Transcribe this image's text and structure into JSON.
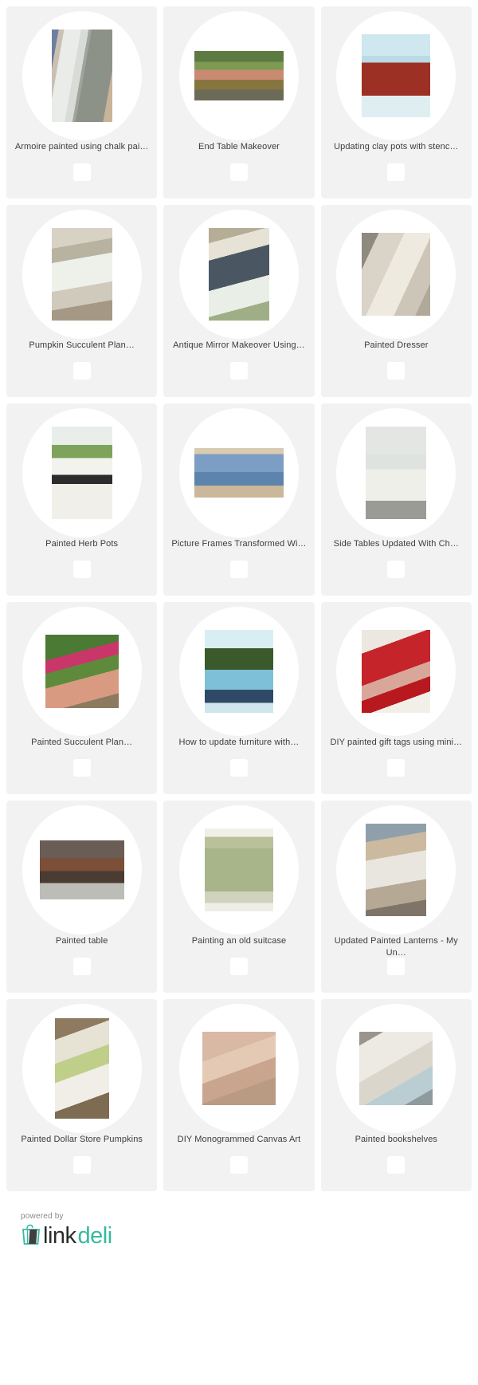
{
  "page": {
    "background_color": "#ffffff",
    "card_background_color": "#f2f2f2",
    "text_color": "#3d3d3d"
  },
  "grid": {
    "columns": 3,
    "items": [
      {
        "title": "Armoire painted using chalk pai…",
        "image": "armoire-thumbnail",
        "shape": "thumb-portrait",
        "img_class": "img-armoire"
      },
      {
        "title": "End Table Makeover",
        "image": "end-table-thumbnail",
        "shape": "thumb-landscape",
        "img_class": "img-endtable"
      },
      {
        "title": "Updating clay pots with stenc…",
        "image": "clay-pots-thumbnail",
        "shape": "thumb-med",
        "img_class": "img-claypot"
      },
      {
        "title": "Pumpkin Succulent Plan…",
        "image": "pumpkin-succulent-thumbnail",
        "shape": "thumb-portrait",
        "img_class": "img-pumpkin"
      },
      {
        "title": "Antique Mirror Makeover Using…",
        "image": "antique-mirror-thumbnail",
        "shape": "thumb-portrait",
        "img_class": "img-mirror"
      },
      {
        "title": "Painted Dresser",
        "image": "painted-dresser-thumbnail",
        "shape": "thumb-med",
        "img_class": "img-dresser"
      },
      {
        "title": "Painted Herb Pots",
        "image": "herb-pots-thumbnail",
        "shape": "thumb-portrait",
        "img_class": "img-herb"
      },
      {
        "title": "Picture Frames Transformed Wi…",
        "image": "picture-frames-thumbnail",
        "shape": "thumb-landscape",
        "img_class": "img-frames"
      },
      {
        "title": "Side Tables Updated With Ch…",
        "image": "side-tables-thumbnail",
        "shape": "thumb-portrait",
        "img_class": "img-sidetable"
      },
      {
        "title": "Painted Succulent Plan…",
        "image": "painted-succulent-thumbnail",
        "shape": "thumb-square",
        "img_class": "img-succulent"
      },
      {
        "title": "How to update furniture with…",
        "image": "update-furniture-thumbnail",
        "shape": "thumb-med",
        "img_class": "img-update"
      },
      {
        "title": "DIY painted gift tags using mini…",
        "image": "gift-tags-thumbnail",
        "shape": "thumb-med",
        "img_class": "img-gifttag"
      },
      {
        "title": "Painted table",
        "image": "painted-table-thumbnail",
        "shape": "thumb-wide",
        "img_class": "img-table"
      },
      {
        "title": "Painting an old suitcase",
        "image": "old-suitcase-thumbnail",
        "shape": "thumb-med",
        "img_class": "img-suitcase"
      },
      {
        "title": "Updated Painted Lanterns - My Un…",
        "image": "painted-lanterns-thumbnail",
        "shape": "thumb-portrait",
        "img_class": "img-lantern"
      },
      {
        "title": "Painted Dollar Store Pumpkins",
        "image": "dollar-store-pumpkins-thumbnail",
        "shape": "thumb-tall",
        "img_class": "img-dollarpumpkin"
      },
      {
        "title": "DIY Monogrammed Canvas Art",
        "image": "monogrammed-canvas-thumbnail",
        "shape": "thumb-square",
        "img_class": "img-monogram"
      },
      {
        "title": "Painted bookshelves",
        "image": "painted-bookshelves-thumbnail",
        "shape": "thumb-square",
        "img_class": "img-bookshelf"
      }
    ]
  },
  "footer": {
    "powered_by": "powered by",
    "logo_first": "link",
    "logo_second": "deli",
    "logo_color": "#35b9a0",
    "logo_text_color": "#2b2b2b"
  }
}
